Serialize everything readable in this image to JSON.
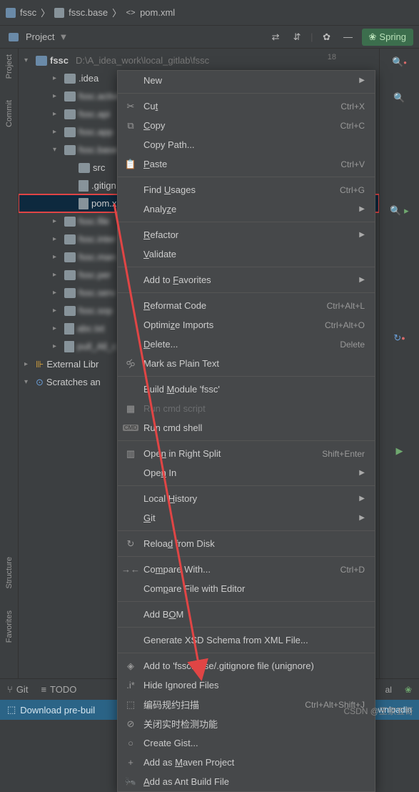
{
  "breadcrumb": {
    "root": "fssc",
    "mid": "fssc.base",
    "file": "pom.xml"
  },
  "toolbar": {
    "project_label": "Project",
    "spring_label": "Spring",
    "line_number": "18"
  },
  "left_rail": {
    "project": "Project",
    "commit": "Commit",
    "structure": "Structure",
    "favorites": "Favorites"
  },
  "tree": {
    "root": {
      "name": "fssc",
      "path": "D:\\A_idea_work\\local_gitlab\\fssc"
    },
    "items": [
      {
        "label": ".idea"
      },
      {
        "label": "fssc.activi"
      },
      {
        "label": "fssc.api"
      },
      {
        "label": "fssc.app"
      },
      {
        "label": "fssc.base",
        "expanded": true
      },
      {
        "label": "src",
        "child": true
      },
      {
        "label": ".gitign",
        "child": true
      },
      {
        "label": "pom.x",
        "child": true,
        "selected": true,
        "highlighted": true
      },
      {
        "label": "fssc.file"
      },
      {
        "label": "fssc.inter"
      },
      {
        "label": "fssc.man"
      },
      {
        "label": "fssc.per"
      },
      {
        "label": "fssc.serv"
      },
      {
        "label": "fssc.sop"
      },
      {
        "label": "abc.txt"
      },
      {
        "label": "pull_All_c"
      }
    ],
    "external": "External Libr",
    "scratches": "Scratches an"
  },
  "menu": {
    "items": [
      {
        "label": "New",
        "sub": true
      },
      {
        "sep": true
      },
      {
        "icon": "✂",
        "label": "Cut",
        "u": "t",
        "shortcut": "Ctrl+X"
      },
      {
        "icon": "⧉",
        "label": "Copy",
        "u": "C",
        "shortcut": "Ctrl+C"
      },
      {
        "label": "Copy Path..."
      },
      {
        "icon": "📋",
        "label": "Paste",
        "u": "P",
        "shortcut": "Ctrl+V"
      },
      {
        "sep": true
      },
      {
        "label": "Find Usages",
        "u": "U",
        "shortcut": "Ctrl+G"
      },
      {
        "label": "Analyze",
        "u": "z",
        "sub": true
      },
      {
        "sep": true
      },
      {
        "label": "Refactor",
        "u": "R",
        "sub": true
      },
      {
        "label": "Validate",
        "u": "V"
      },
      {
        "sep": true
      },
      {
        "label": "Add to Favorites",
        "u": "F",
        "sub": true
      },
      {
        "sep": true
      },
      {
        "label": "Reformat Code",
        "u": "R",
        "shortcut": "Ctrl+Alt+L"
      },
      {
        "label": "Optimize Imports",
        "u": "z",
        "shortcut": "Ctrl+Alt+O"
      },
      {
        "label": "Delete...",
        "u": "D",
        "shortcut": "Delete"
      },
      {
        "icon": "🝰",
        "label": "Mark as Plain Text"
      },
      {
        "sep": true
      },
      {
        "label": "Build Module 'fssc'",
        "u": "M"
      },
      {
        "icon": "▦",
        "label": "Run cmd script",
        "disabled": true
      },
      {
        "icon": "cmd",
        "label": "Run cmd shell"
      },
      {
        "sep": true
      },
      {
        "icon": "▥",
        "label": "Open in Right Split",
        "u": "n",
        "shortcut": "Shift+Enter"
      },
      {
        "label": "Open In",
        "u": "n",
        "sub": true
      },
      {
        "sep": true
      },
      {
        "label": "Local History",
        "u": "H",
        "sub": true
      },
      {
        "label": "Git",
        "u": "G",
        "sub": true
      },
      {
        "sep": true
      },
      {
        "icon": "↻",
        "label": "Reload from Disk",
        "u": "d"
      },
      {
        "sep": true
      },
      {
        "icon": "→←",
        "label": "Compare With...",
        "u": "m",
        "shortcut": "Ctrl+D"
      },
      {
        "label": "Compare File with Editor",
        "u": "p"
      },
      {
        "sep": true
      },
      {
        "label": "Add BOM",
        "u": "O"
      },
      {
        "sep": true
      },
      {
        "label": "Generate XSD Schema from XML File..."
      },
      {
        "sep": true
      },
      {
        "icon": "◈",
        "label": "Add to 'fssc.base/.gitignore file (unignore)"
      },
      {
        "icon": ".i*",
        "label": "Hide Ignored Files"
      },
      {
        "icon": "⬚",
        "label": "编码规约扫描",
        "shortcut": "Ctrl+Alt+Shift+J"
      },
      {
        "icon": "⊘",
        "label": "关闭实时检测功能"
      },
      {
        "icon": "○",
        "label": "Create Gist..."
      },
      {
        "icon": "+",
        "label": "Add as Maven Project",
        "u": "M"
      },
      {
        "icon": "🐜",
        "label": "Add as Ant Build File",
        "u": "A"
      }
    ]
  },
  "bottom": {
    "git": "Git",
    "todo": "TODO",
    "right": "al"
  },
  "status": {
    "text": "Download pre-buil",
    "right": "wnloadin"
  },
  "watermark": "CSDN @王家五哥"
}
